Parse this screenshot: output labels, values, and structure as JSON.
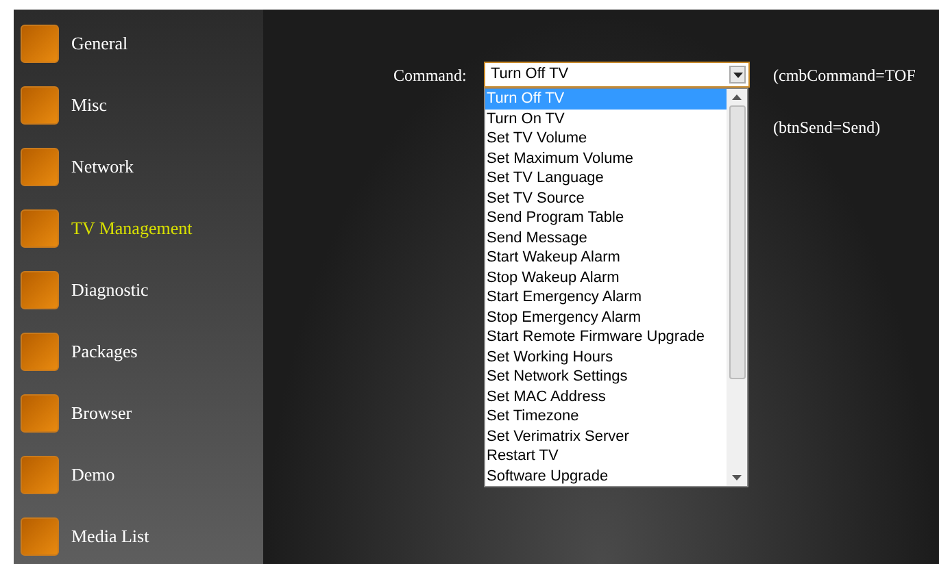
{
  "sidebar": {
    "items": [
      {
        "label": "General",
        "selected": false
      },
      {
        "label": "Misc",
        "selected": false
      },
      {
        "label": "Network",
        "selected": false
      },
      {
        "label": "TV Management",
        "selected": true
      },
      {
        "label": "Diagnostic",
        "selected": false
      },
      {
        "label": "Packages",
        "selected": false
      },
      {
        "label": "Browser",
        "selected": false
      },
      {
        "label": "Demo",
        "selected": false
      },
      {
        "label": "Media List",
        "selected": false
      }
    ]
  },
  "form": {
    "command_label": "Command:",
    "command_value": "Turn Off TV",
    "command_note": "(cmbCommand=TOF",
    "send_note": "(btnSend=Send)",
    "options": [
      {
        "label": "Turn Off TV",
        "selected": true
      },
      {
        "label": "Turn On TV",
        "selected": false
      },
      {
        "label": "Set TV Volume",
        "selected": false
      },
      {
        "label": "Set Maximum Volume",
        "selected": false
      },
      {
        "label": "Set TV Language",
        "selected": false
      },
      {
        "label": "Set TV Source",
        "selected": false
      },
      {
        "label": "Send Program Table",
        "selected": false
      },
      {
        "label": "Send Message",
        "selected": false
      },
      {
        "label": "Start Wakeup Alarm",
        "selected": false
      },
      {
        "label": "Stop Wakeup Alarm",
        "selected": false
      },
      {
        "label": "Start Emergency Alarm",
        "selected": false
      },
      {
        "label": "Stop Emergency Alarm",
        "selected": false
      },
      {
        "label": "Start Remote Firmware Upgrade",
        "selected": false
      },
      {
        "label": "Set Working Hours",
        "selected": false
      },
      {
        "label": "Set Network Settings",
        "selected": false
      },
      {
        "label": "Set MAC Address",
        "selected": false
      },
      {
        "label": "Set Timezone",
        "selected": false
      },
      {
        "label": "Set Verimatrix Server",
        "selected": false
      },
      {
        "label": "Restart TV",
        "selected": false
      },
      {
        "label": "Software Upgrade",
        "selected": false
      }
    ]
  }
}
